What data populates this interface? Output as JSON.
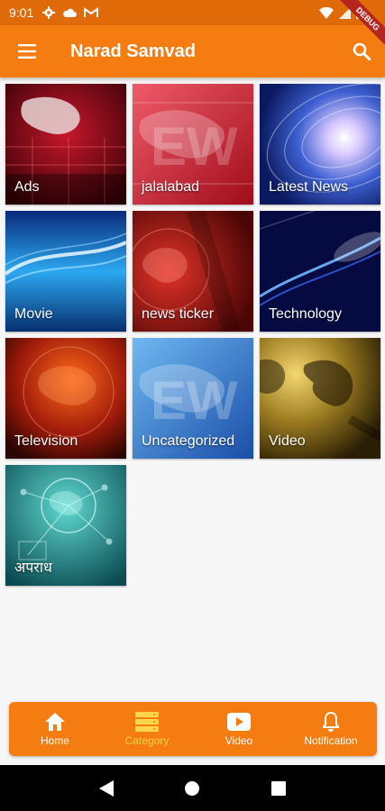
{
  "status_bar": {
    "time": "9:01"
  },
  "debug_banner": "DEBUG",
  "app_bar": {
    "title": "Narad Samvad"
  },
  "categories": [
    {
      "label": "Ads",
      "theme": "red-studio"
    },
    {
      "label": "jalalabad",
      "theme": "red-news"
    },
    {
      "label": "Latest News",
      "theme": "blue-swirl"
    },
    {
      "label": "Movie",
      "theme": "blue-streak"
    },
    {
      "label": "news ticker",
      "theme": "red-globe"
    },
    {
      "label": "Technology",
      "theme": "dark-blue-streak"
    },
    {
      "label": "Television",
      "theme": "orange-globe"
    },
    {
      "label": "Uncategorized",
      "theme": "blue-news"
    },
    {
      "label": "Video",
      "theme": "gold-map"
    },
    {
      "label": "अपराध",
      "theme": "teal-network"
    }
  ],
  "bottom_nav": {
    "items": [
      {
        "label": "Home",
        "icon": "home-icon"
      },
      {
        "label": "Category",
        "icon": "category-icon",
        "active": true
      },
      {
        "label": "Video",
        "icon": "video-icon"
      },
      {
        "label": "Notification",
        "icon": "bell-icon"
      }
    ]
  },
  "colors": {
    "primary": "#f57c10",
    "status": "#e06a08",
    "active_nav": "#ffd54a"
  }
}
